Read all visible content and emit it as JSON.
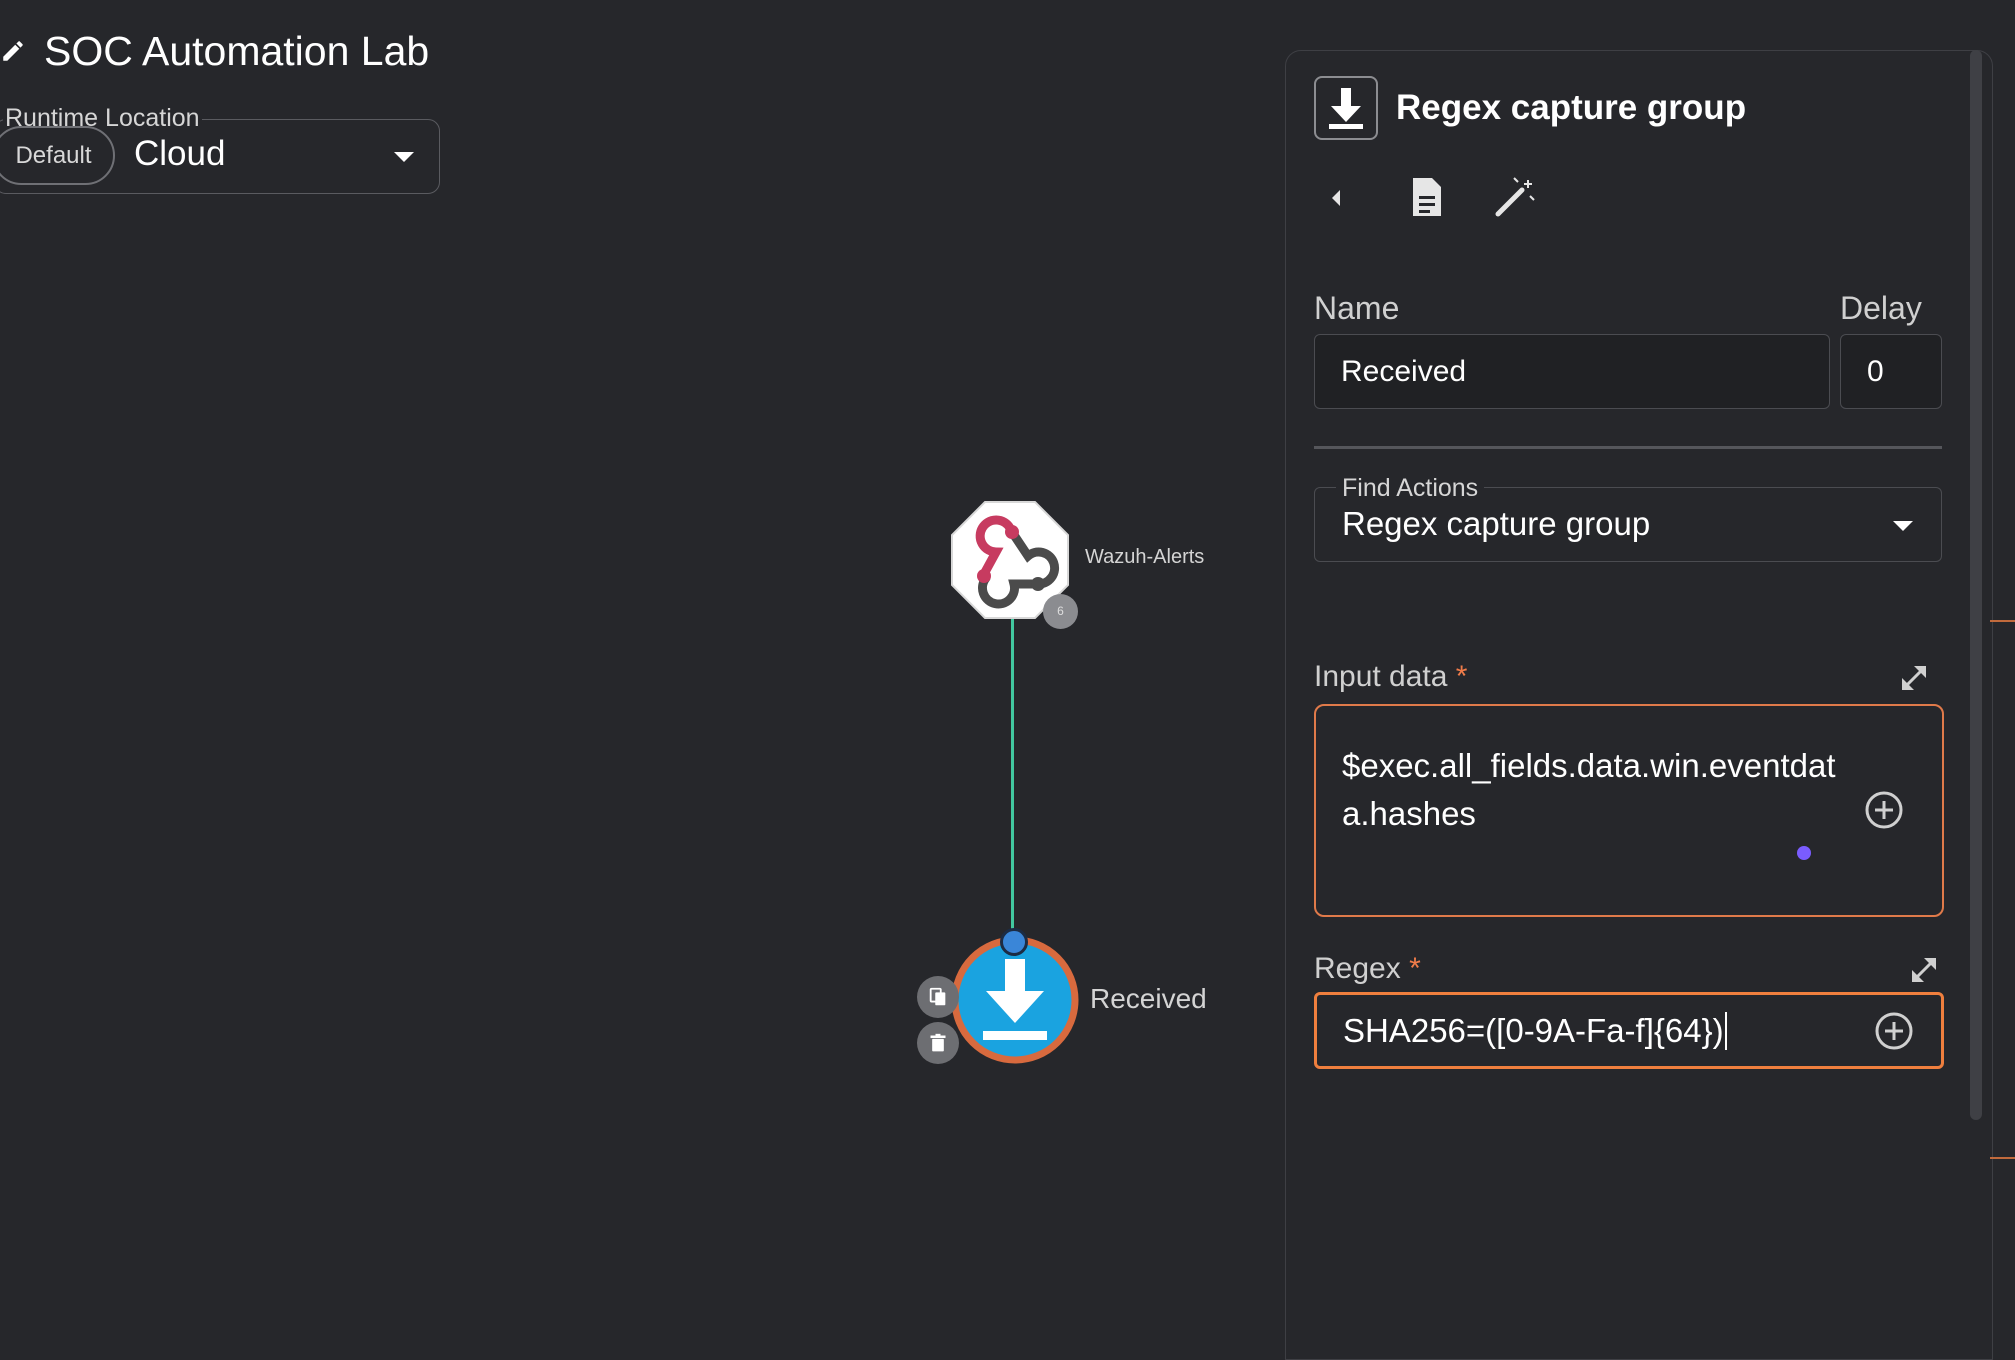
{
  "workflow": {
    "title": "SOC Automation Lab",
    "runtime_location_label": "Runtime Location",
    "runtime_default_chip": "Default",
    "runtime_value": "Cloud"
  },
  "canvas": {
    "nodes": [
      {
        "label": "Wazuh-Alerts",
        "icon": "webhook-icon",
        "badge": "6"
      },
      {
        "label": "Received",
        "icon": "download-icon"
      }
    ],
    "connector_color": "#42c8a0"
  },
  "panel": {
    "title": "Regex capture group",
    "header_icon": "download-icon",
    "toolbar": [
      "back-arrow-icon",
      "document-icon",
      "magic-wand-icon"
    ],
    "name_label": "Name",
    "name_value": "Received",
    "delay_label": "Delay",
    "delay_value": "0",
    "find_actions_label": "Find Actions",
    "find_actions_value": "Regex capture group",
    "input_data_label": "Input data",
    "input_data_value": "$exec.all_fields.data.win.eventdata.hashes",
    "regex_label": "Regex",
    "regex_value": "SHA256=([0-9A-Fa-f]{64})",
    "required_marker": "*"
  },
  "colors": {
    "background": "#26272b",
    "accent_orange": "#ef7f3e",
    "node_blue": "#1aa3e0",
    "required": "#f07c4a"
  }
}
